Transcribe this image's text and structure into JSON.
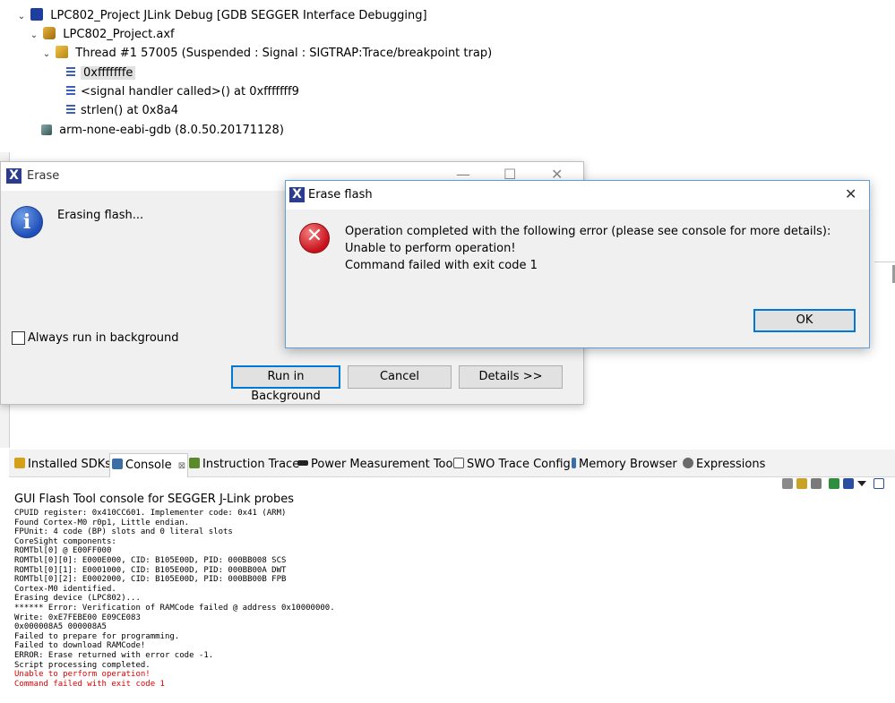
{
  "debug_tree": {
    "launch": "LPC802_Project JLink Debug [GDB SEGGER Interface Debugging]",
    "axf": "LPC802_Project.axf",
    "thread": "Thread #1 57005 (Suspended : Signal : SIGTRAP:Trace/breakpoint trap)",
    "frames": [
      "0xfffffffe",
      "<signal handler called>() at 0xfffffff9",
      "strlen() at 0x8a4"
    ],
    "gdb": "arm-none-eabi-gdb (8.0.50.20171128)"
  },
  "erase_dialog": {
    "title": "Erase",
    "message": "Erasing flash...",
    "checkbox_label": "Always run in background",
    "buttons": [
      "Run in Background",
      "Cancel",
      "Details >>"
    ]
  },
  "erase_flash_dialog": {
    "title": "Erase flash",
    "lines": [
      "Operation completed with the following error (please see console for more details):",
      "Unable to perform operation!",
      "Command failed with exit code 1"
    ],
    "ok_label": "OK"
  },
  "tabs": [
    {
      "label": "Installed SDKs",
      "icon": "sdk-icon",
      "color": "#d4a017"
    },
    {
      "label": "Console",
      "icon": "console-icon",
      "color": "#3a6ea5",
      "active": true,
      "close": "⊠"
    },
    {
      "label": "Instruction Trace",
      "icon": "trace-icon",
      "color": "#5a8a2a"
    },
    {
      "label": "Power Measurement Tool",
      "icon": "power-icon",
      "color": "#222222"
    },
    {
      "label": "SWO Trace Config",
      "icon": "swo-icon",
      "color": "#555555"
    },
    {
      "label": "Memory Browser",
      "icon": "memory-icon",
      "color": "#3a6ea5"
    },
    {
      "label": "Expressions",
      "icon": "expressions-icon",
      "color": "#6a6a6a"
    }
  ],
  "console": {
    "title": "GUI Flash Tool console for SEGGER J-Link probes",
    "lines": [
      "CPUID register: 0x410CC601. Implementer code: 0x41 (ARM)",
      "Found Cortex-M0 r0p1, Little endian.",
      "FPUnit: 4 code (BP) slots and 0 literal slots",
      "CoreSight components:",
      "ROMTbl[0] @ E00FF000",
      "ROMTbl[0][0]: E000E000, CID: B105E00D, PID: 000BB008 SCS",
      "ROMTbl[0][1]: E0001000, CID: B105E00D, PID: 000BB00A DWT",
      "ROMTbl[0][2]: E0002000, CID: B105E00D, PID: 000BB00B FPB",
      "Cortex-M0 identified.",
      "Erasing device (LPC802)...",
      "****** Error: Verification of RAMCode failed @ address 0x10000000.",
      "Write: 0xE7FEBE00 E09CE083",
      "0x000008A5 000008A5",
      "Failed to prepare for programming.",
      "Failed to download RAMCode!",
      "ERROR: Erase returned with error code -1.",
      "Script processing completed."
    ],
    "error_lines": [
      "Unable to perform operation!",
      "Command failed with exit code 1"
    ]
  },
  "colors": {
    "accent": "#0078d7",
    "error": "#e00000",
    "window_bg": "#f0f0f0"
  }
}
